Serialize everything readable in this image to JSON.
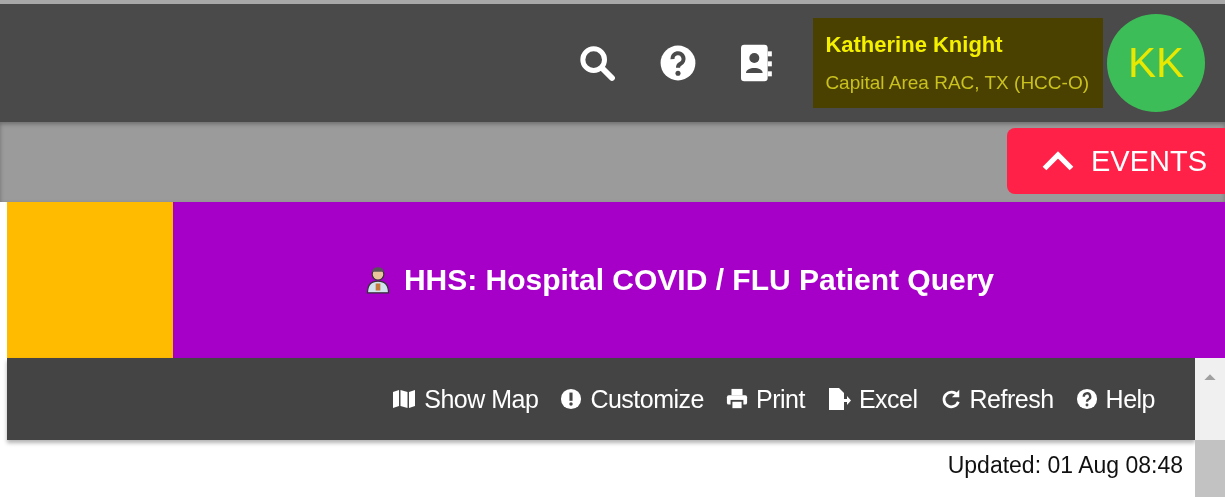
{
  "header": {
    "user": {
      "name": "Katherine Knight",
      "organization": "Capital Area RAC, TX (HCC-O)",
      "initials": "KK"
    }
  },
  "events_button": {
    "label": "EVENTS",
    "expanded": true
  },
  "banner": {
    "title": "HHS: Hospital COVID / FLU Patient Query"
  },
  "toolbar": [
    {
      "kind": "map",
      "label": "Show Map"
    },
    {
      "kind": "info",
      "label": "Customize"
    },
    {
      "kind": "print",
      "label": "Print"
    },
    {
      "kind": "excel",
      "label": "Excel"
    },
    {
      "kind": "refresh",
      "label": "Refresh"
    },
    {
      "kind": "help",
      "label": "Help"
    }
  ],
  "updated": "Updated: 01 Aug 08:48"
}
